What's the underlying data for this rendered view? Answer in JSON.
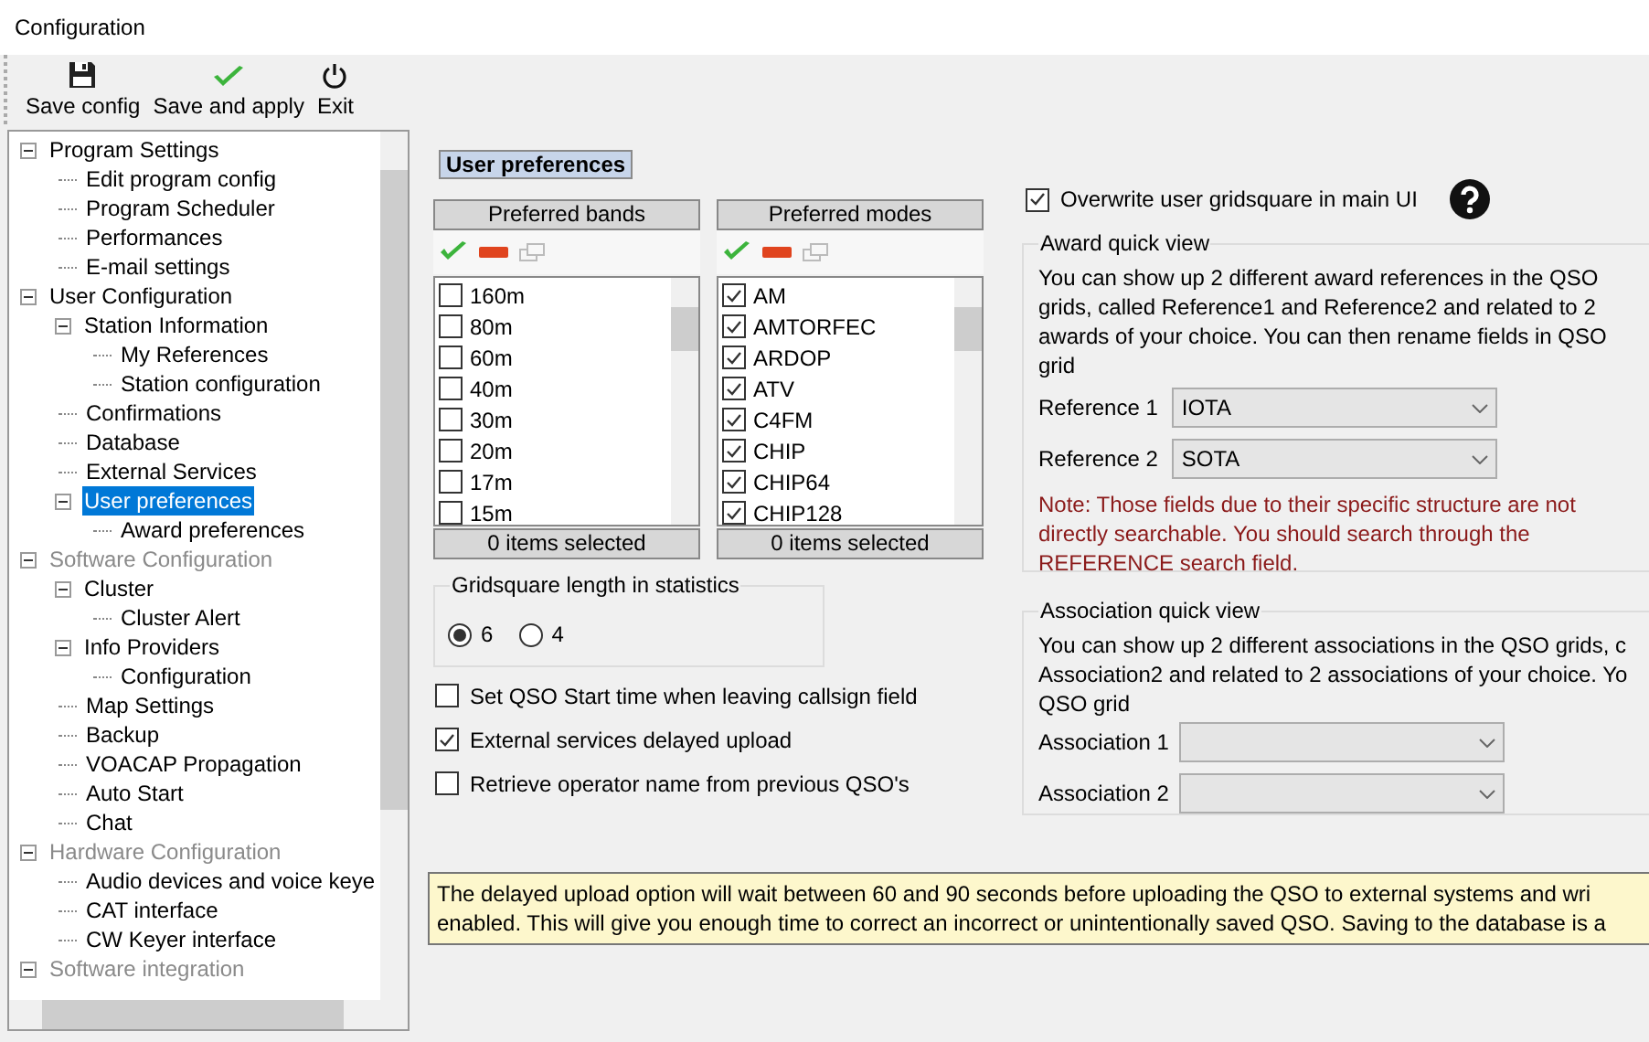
{
  "window": {
    "title": "Configuration"
  },
  "toolbar": [
    {
      "kind": "save",
      "label": "Save config"
    },
    {
      "kind": "apply",
      "label": "Save and apply"
    },
    {
      "kind": "exit",
      "label": "Exit"
    }
  ],
  "tree": [
    {
      "label": "Program Settings",
      "greyed": false,
      "selected": false,
      "expanded": true,
      "children": [
        {
          "label": "Edit program config",
          "greyed": false,
          "selected": false
        },
        {
          "label": "Program Scheduler",
          "greyed": false,
          "selected": false
        },
        {
          "label": "Performances",
          "greyed": false,
          "selected": false
        },
        {
          "label": "E-mail settings",
          "greyed": false,
          "selected": false
        }
      ]
    },
    {
      "label": "User Configuration",
      "greyed": false,
      "selected": false,
      "expanded": true,
      "children": [
        {
          "label": "Station Information",
          "greyed": false,
          "selected": false,
          "expanded": true,
          "children": [
            {
              "label": "My References",
              "greyed": false,
              "selected": false
            },
            {
              "label": "Station configuration",
              "greyed": false,
              "selected": false
            }
          ]
        },
        {
          "label": "Confirmations",
          "greyed": false,
          "selected": false
        },
        {
          "label": "Database",
          "greyed": false,
          "selected": false
        },
        {
          "label": "External Services",
          "greyed": false,
          "selected": false
        },
        {
          "label": "User preferences",
          "greyed": false,
          "selected": true,
          "expanded": true,
          "children": [
            {
              "label": "Award preferences",
              "greyed": false,
              "selected": false
            }
          ]
        }
      ]
    },
    {
      "label": "Software Configuration",
      "greyed": true,
      "selected": false,
      "expanded": true,
      "children": [
        {
          "label": "Cluster",
          "greyed": false,
          "selected": false,
          "expanded": true,
          "children": [
            {
              "label": "Cluster Alert",
              "greyed": false,
              "selected": false
            }
          ]
        },
        {
          "label": "Info Providers",
          "greyed": false,
          "selected": false,
          "expanded": true,
          "children": [
            {
              "label": "Configuration",
              "greyed": false,
              "selected": false
            }
          ]
        },
        {
          "label": "Map Settings",
          "greyed": false,
          "selected": false
        },
        {
          "label": "Backup",
          "greyed": false,
          "selected": false
        },
        {
          "label": "VOACAP Propagation",
          "greyed": false,
          "selected": false
        },
        {
          "label": "Auto Start",
          "greyed": false,
          "selected": false
        },
        {
          "label": "Chat",
          "greyed": false,
          "selected": false
        }
      ]
    },
    {
      "label": "Hardware Configuration",
      "greyed": true,
      "selected": false,
      "expanded": true,
      "children": [
        {
          "label": "Audio devices and voice keye",
          "greyed": false,
          "selected": false
        },
        {
          "label": "CAT interface",
          "greyed": false,
          "selected": false
        },
        {
          "label": "CW Keyer interface",
          "greyed": false,
          "selected": false
        }
      ]
    },
    {
      "label": "Software integration",
      "greyed": true,
      "selected": false,
      "expanded": true
    }
  ],
  "section_title": "User preferences",
  "lists": [
    {
      "header": "Preferred bands",
      "footer": "0 items selected",
      "items": [
        {
          "label": "160m",
          "checked": false
        },
        {
          "label": "80m",
          "checked": false
        },
        {
          "label": "60m",
          "checked": false
        },
        {
          "label": "40m",
          "checked": false
        },
        {
          "label": "30m",
          "checked": false
        },
        {
          "label": "20m",
          "checked": false
        },
        {
          "label": "17m",
          "checked": false
        },
        {
          "label": "15m",
          "checked": false
        }
      ]
    },
    {
      "header": "Preferred modes",
      "footer": "0 items selected",
      "items": [
        {
          "label": "AM",
          "checked": true
        },
        {
          "label": "AMTORFEC",
          "checked": true
        },
        {
          "label": "ARDOP",
          "checked": true
        },
        {
          "label": "ATV",
          "checked": true
        },
        {
          "label": "C4FM",
          "checked": true
        },
        {
          "label": "CHIP",
          "checked": true
        },
        {
          "label": "CHIP64",
          "checked": true
        },
        {
          "label": "CHIP128",
          "checked": true
        }
      ]
    }
  ],
  "gridsquare": {
    "title": "Gridsquare length in statistics",
    "options": [
      {
        "label": "6",
        "selected": true
      },
      {
        "label": "4",
        "selected": false
      }
    ]
  },
  "options": [
    {
      "label": "Set QSO Start time when leaving callsign field",
      "checked": false
    },
    {
      "label": "External services delayed upload",
      "checked": true
    },
    {
      "label": "Retrieve operator name from previous QSO's",
      "checked": false
    }
  ],
  "overwrite": {
    "label": "Overwrite user gridsquare in main UI",
    "checked": true
  },
  "award_quick_view": {
    "title": "Award quick view",
    "description": [
      "You can show up 2 different award references in the QSO",
      "grids, called Reference1 and Reference2 and related to 2",
      "awards of your choice. You can then rename fields in QSO",
      "grid"
    ],
    "fields": [
      {
        "label": "Reference 1",
        "value": "IOTA"
      },
      {
        "label": "Reference 2",
        "value": "SOTA"
      }
    ],
    "note": [
      "Note: Those fields due to their specific structure are not",
      "directly searchable. You should search through the",
      "REFERENCE search field."
    ]
  },
  "association_quick_view": {
    "title": "Association quick view",
    "description": [
      "You can show up 2 different associations in the QSO grids, c",
      "Association2 and related to 2 associations of your choice. Yo",
      "QSO grid"
    ],
    "fields": [
      {
        "label": "Association 1"
      },
      {
        "label": "Association 2"
      }
    ]
  },
  "info_banner": [
    "The delayed upload option will wait between 60 and 90 seconds before uploading the QSO to external systems and wri",
    "enabled. This will give you enough time to correct an incorrect or unintentionally saved QSO. Saving to the database is a"
  ]
}
